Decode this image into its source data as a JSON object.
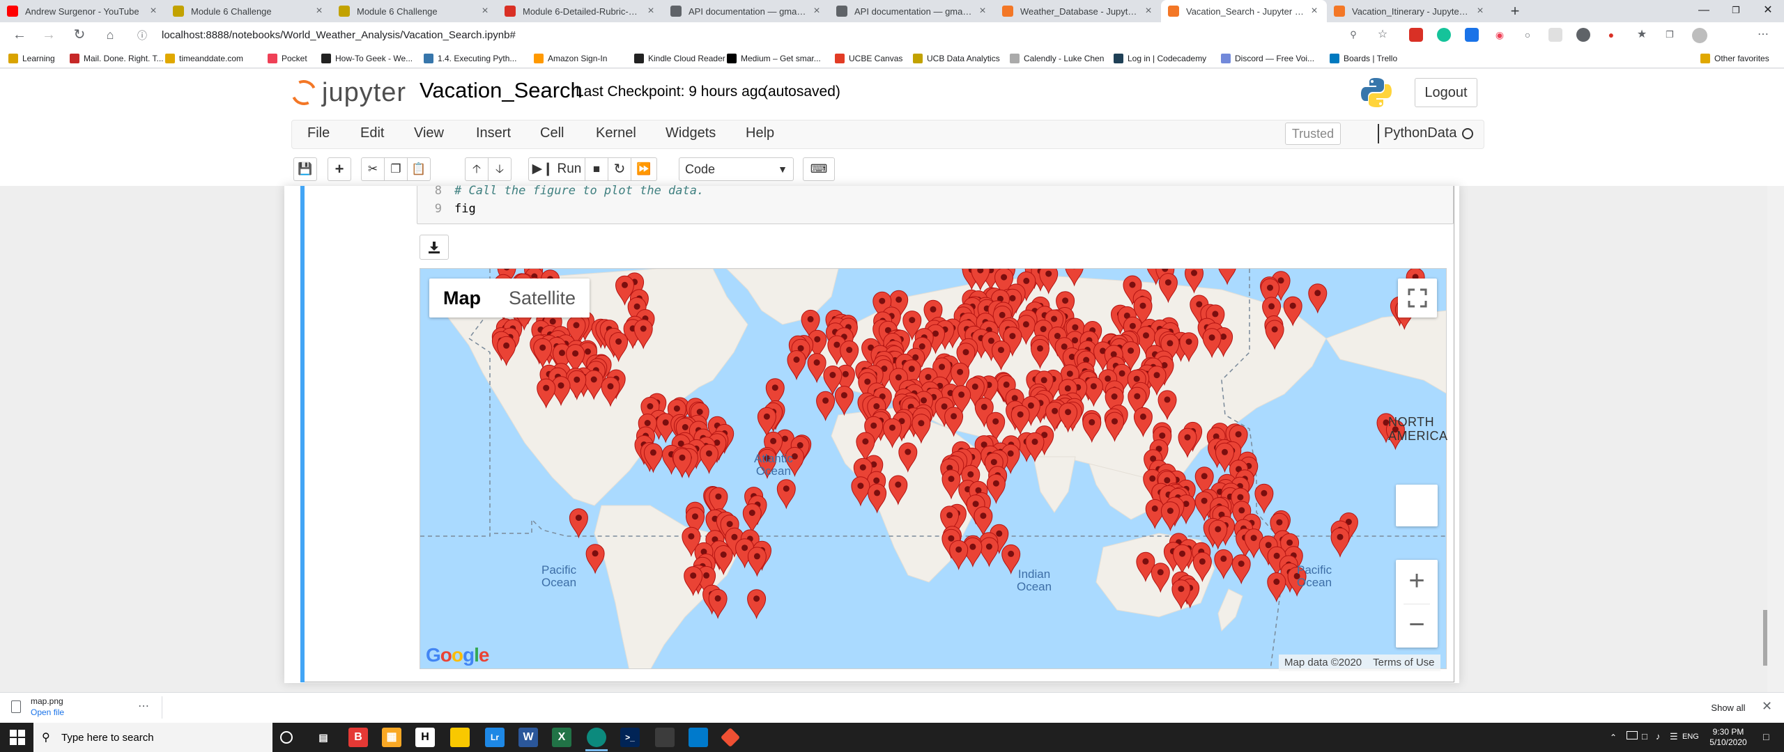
{
  "browser": {
    "tabs": [
      {
        "title": "Andrew Surgenor - YouTube",
        "fav_color": "#ff0000",
        "active": false
      },
      {
        "title": "Module 6 Challenge",
        "fav_color": "#c2a200",
        "active": false
      },
      {
        "title": "Module 6 Challenge",
        "fav_color": "#c2a200",
        "active": false
      },
      {
        "title": "Module 6-Detailed-Rubric-Pytho",
        "fav_color": "#d93025",
        "active": false
      },
      {
        "title": "API documentation — gmaps 0.9",
        "fav_color": "#5f6368",
        "active": false
      },
      {
        "title": "API documentation — gmaps 0.9",
        "fav_color": "#5f6368",
        "active": false
      },
      {
        "title": "Weather_Database - Jupyter Note",
        "fav_color": "#f37726",
        "active": false
      },
      {
        "title": "Vacation_Search - Jupyter Noteb",
        "fav_color": "#f37726",
        "active": true
      },
      {
        "title": "Vacation_Itinerary - Jupyter Note",
        "fav_color": "#f37726",
        "active": false
      }
    ],
    "url": "localhost:8888/notebooks/World_Weather_Analysis/Vacation_Search.ipynb#",
    "bookmarks": [
      {
        "label": "Learning",
        "color": "#d9a300"
      },
      {
        "label": "Mail. Done. Right. T...",
        "color": "#c62828"
      },
      {
        "label": "timeanddate.com",
        "color": "#e0a800"
      },
      {
        "label": "Pocket",
        "color": "#ef4056"
      },
      {
        "label": "How-To Geek - We...",
        "color": "#222222"
      },
      {
        "label": "1.4. Executing Pyth...",
        "color": "#3776ab"
      },
      {
        "label": "Amazon Sign-In",
        "color": "#ff9900"
      },
      {
        "label": "Kindle Cloud Reader",
        "color": "#222222"
      },
      {
        "label": "Medium – Get smar...",
        "color": "#000000"
      },
      {
        "label": "UCBE Canvas",
        "color": "#e23c25"
      },
      {
        "label": "UCB Data Analytics",
        "color": "#c2a200"
      },
      {
        "label": "Calendly - Luke Chen",
        "color": "#aaaaaa"
      },
      {
        "label": "Log in | Codecademy",
        "color": "#1f4056"
      },
      {
        "label": "Discord — Free Voi...",
        "color": "#7289da"
      },
      {
        "label": "Boards | Trello",
        "color": "#0079bf"
      }
    ],
    "other_favorites": "Other favorites"
  },
  "jupyter": {
    "logo_text": "jupyter",
    "notebook_name": "Vacation_Search",
    "checkpoint": "Last Checkpoint: 9 hours ago",
    "autosave": "(autosaved)",
    "logout": "Logout",
    "menus": [
      "File",
      "Edit",
      "View",
      "Insert",
      "Cell",
      "Kernel",
      "Widgets",
      "Help"
    ],
    "trusted": "Trusted",
    "kernel": "PythonData",
    "run_label": "Run",
    "cell_type": "Code"
  },
  "code": {
    "lines": [
      {
        "num": "8",
        "text": "# Call the figure to plot the data."
      },
      {
        "num": "9",
        "text": "fig"
      }
    ]
  },
  "map": {
    "type_map": "Map",
    "type_satellite": "Satellite",
    "labels": {
      "atlantic": "Atlantic\nOcean",
      "pacific_left": "Pacific\nOcean",
      "pacific_right": "Pacific\nOcean",
      "indian": "Indian\nOcean",
      "north_america": "NORTH\nAMERICA"
    },
    "google": "Google",
    "map_data": "Map data ©2020",
    "terms": "Terms of Use",
    "marker_color": "#ea4335",
    "land_color": "#f2efe9",
    "water_color": "#aadaff"
  },
  "downloads": {
    "file": "map.png",
    "open": "Open file",
    "show_all": "Show all"
  },
  "taskbar": {
    "search": "Type here to search",
    "lang": "ENG",
    "time": "9:30 PM",
    "date": "5/10/2020"
  }
}
